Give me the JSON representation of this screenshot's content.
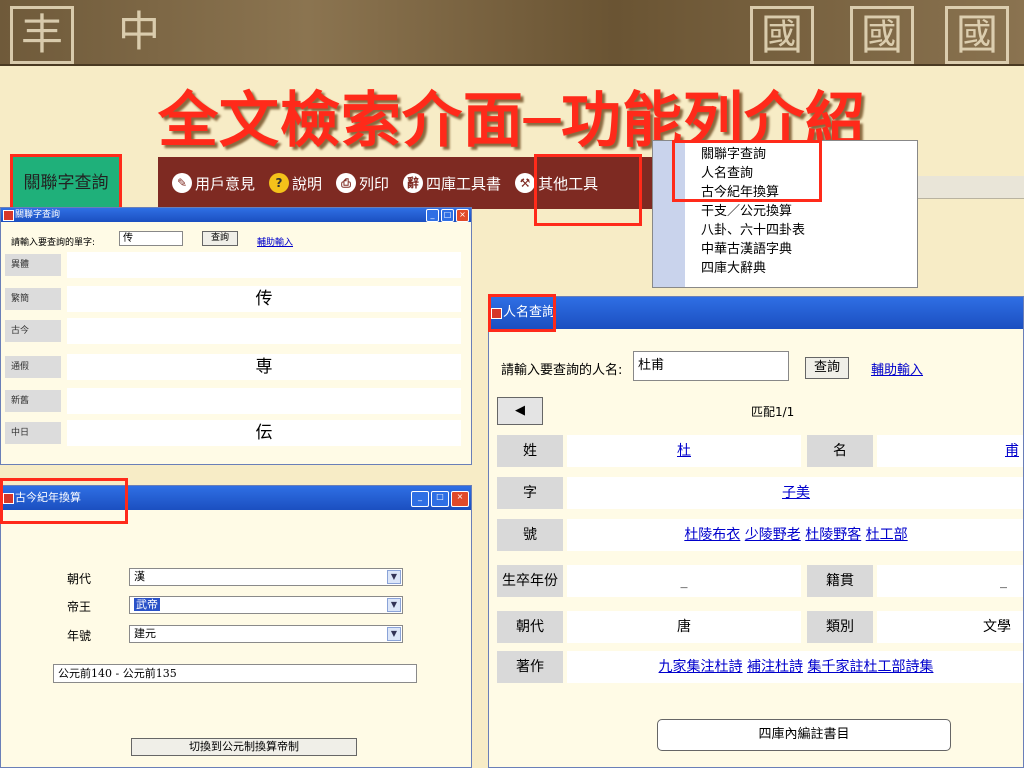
{
  "banner": {
    "glyphs": [
      "丰",
      "中",
      "國",
      "國",
      "國"
    ]
  },
  "slide_title": "全文檢索介面─功能列介紹",
  "keyword_badge": "關聯字查詢",
  "toolbar": {
    "items": [
      {
        "label": "用戶意見",
        "icon": "feedback-icon"
      },
      {
        "label": "說明",
        "icon": "help-icon"
      },
      {
        "label": "列印",
        "icon": "print-icon"
      },
      {
        "label": "四庫工具書",
        "icon": "reference-books-icon"
      },
      {
        "label": "其他工具",
        "icon": "tools-icon"
      }
    ]
  },
  "menu": {
    "items": [
      "關聯字查詢",
      "人名查詢",
      "古今紀年換算",
      "干支／公元換算",
      "八卦、六十四卦表",
      "中華古漢語字典",
      "四庫大辭典"
    ]
  },
  "keyword_window": {
    "title": "關聯字查詢",
    "prompt": "請輸入要查詢的單字:",
    "input_value": "传",
    "search_label": "查詢",
    "assist_label": "輔助輸入",
    "rows": [
      {
        "label": "異體",
        "value": ""
      },
      {
        "label": "繁簡",
        "value": "传"
      },
      {
        "label": "古今",
        "value": ""
      },
      {
        "label": "通假",
        "value": "専"
      },
      {
        "label": "新舊",
        "value": ""
      },
      {
        "label": "中日",
        "value": "伝"
      }
    ]
  },
  "person_window": {
    "title": "人名查詢",
    "prompt": "請輸入要查詢的人名:",
    "input_value": "杜甫",
    "search_label": "查詢",
    "assist_label": "輔助輸入",
    "match_text": "匹配1/1",
    "labels": {
      "surname": "姓",
      "given": "名",
      "courtesy": "字",
      "alias": "號",
      "lifespan": "生卒年份",
      "native": "籍貫",
      "dynasty": "朝代",
      "category": "類別",
      "works": "著作"
    },
    "values": {
      "surname": "杜",
      "given": "甫",
      "courtesy": "子美",
      "aliases": [
        "杜陵布衣",
        "少陵野老",
        "杜陵野客",
        "杜工部"
      ],
      "lifespan": "_",
      "native": "_",
      "dynasty": "唐",
      "category": "文學",
      "works": [
        "九家集注杜詩",
        "補注杜詩",
        "集千家註杜工部詩集"
      ]
    },
    "bottom_button": "四庫內編註書目"
  },
  "era_window": {
    "title": "古今紀年換算",
    "fields": [
      {
        "label": "朝代",
        "value": "漢"
      },
      {
        "label": "帝王",
        "value": "武帝"
      },
      {
        "label": "年號",
        "value": "建元"
      }
    ],
    "result": "公元前140 - 公元前135",
    "switch_button": "切換到公元制換算帝制"
  },
  "colors": {
    "title_red": "#ff2a1a",
    "toolbar_bg": "#7e2a22",
    "window_blue": "#1b4fc0",
    "highlight_red": "#ff2a1a",
    "link_blue": "#0000cc"
  }
}
